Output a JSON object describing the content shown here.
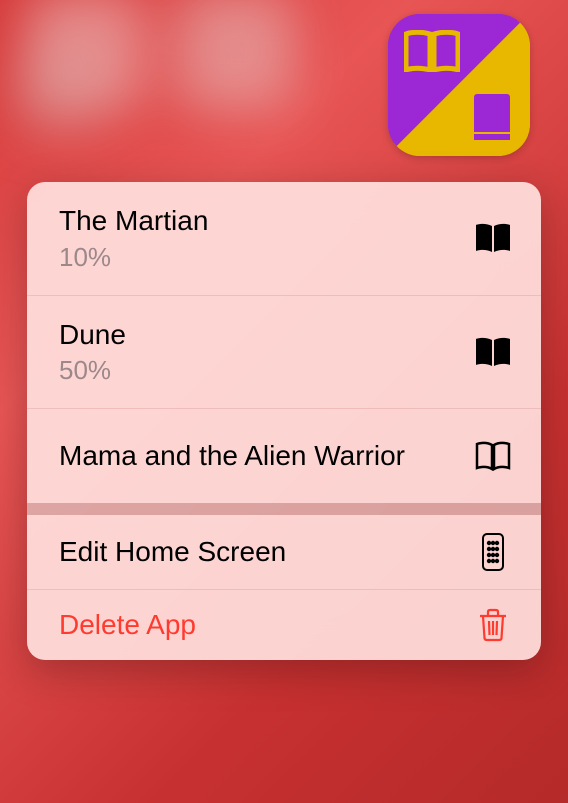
{
  "appIcon": {
    "name": "reading-app"
  },
  "menu": {
    "books": [
      {
        "title": "The Martian",
        "progress": "10%",
        "status": "reading"
      },
      {
        "title": "Dune",
        "progress": "50%",
        "status": "reading"
      },
      {
        "title": "Mama and the Alien Warrior",
        "progress": null,
        "status": "unread"
      }
    ],
    "system": {
      "edit": "Edit Home Screen",
      "delete": "Delete App"
    }
  }
}
